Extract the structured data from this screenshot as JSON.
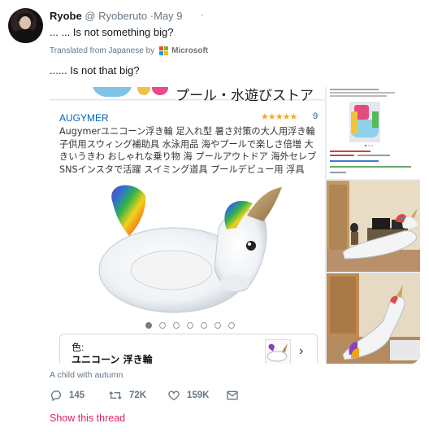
{
  "author": {
    "name": "Ryobe",
    "handle": "@ Ryoberuto",
    "separator": "·",
    "date": "May 9",
    "caret": "·"
  },
  "tweet": {
    "text": "... ... Is not something big?",
    "translated_from": "Translated from Japanese by",
    "translator": "Microsoft",
    "translated_text": "...... Is not that big?"
  },
  "media": {
    "banner_text": "プール・水遊びストア",
    "product": {
      "brand": "AUGYMER",
      "stars": "★★★★★",
      "rating_count": "9",
      "title": "Augymerユニコーン浮き輪 足入れ型 暑さ対策の大人用浮き輪 子供用スウィング補助具 水泳用品 海やプールで楽しさ倍増 大きいうきわ おしゃれな乗り物 海 プールアウトドア 海外セレブ SNSインスタで活躍 スイミング道具 プールデビュー用 浮具",
      "carousel_count": 7,
      "carousel_active": 0,
      "variant_label": "色:",
      "variant_value": "ユニコーン 浮き輪",
      "variant_arrow": "›"
    },
    "caption": "A child with autumn"
  },
  "actions": {
    "replies": "145",
    "retweets": "72K",
    "likes": "159K"
  },
  "show_thread": "Show this thread",
  "colors": {
    "link": "#0066c0",
    "muted": "#657786",
    "thread": "#e0245e",
    "ms_red": "#f25022",
    "ms_green": "#7fba00",
    "ms_blue": "#00a4ef",
    "ms_yellow": "#ffb900"
  }
}
